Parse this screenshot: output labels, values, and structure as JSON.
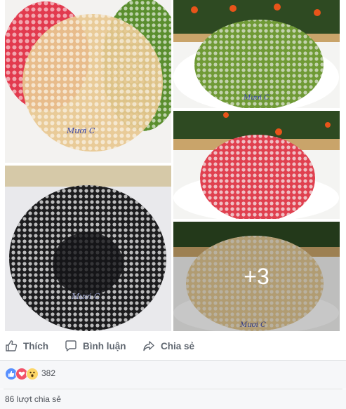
{
  "photos": {
    "p1": {
      "watermark": "Mươi C"
    },
    "p2": {
      "watermark": "Mươi C"
    },
    "p3": {
      "watermark": "Mươi C"
    },
    "p5": {
      "watermark": "Mươi C"
    },
    "more_count": "+3"
  },
  "actions": {
    "like_label": "Thích",
    "comment_label": "Bình luận",
    "share_label": "Chia sẻ"
  },
  "reactions": {
    "icons": [
      "like-icon",
      "love-icon",
      "wow-icon"
    ],
    "count": "382"
  },
  "shares": {
    "text": "86 lượt chia sẻ"
  },
  "colors": {
    "action_text": "#606770",
    "footer_bg": "#f6f7f9",
    "like_blue": "#5890ff",
    "love_red": "#f25268",
    "wow_yellow": "#fcd667"
  }
}
